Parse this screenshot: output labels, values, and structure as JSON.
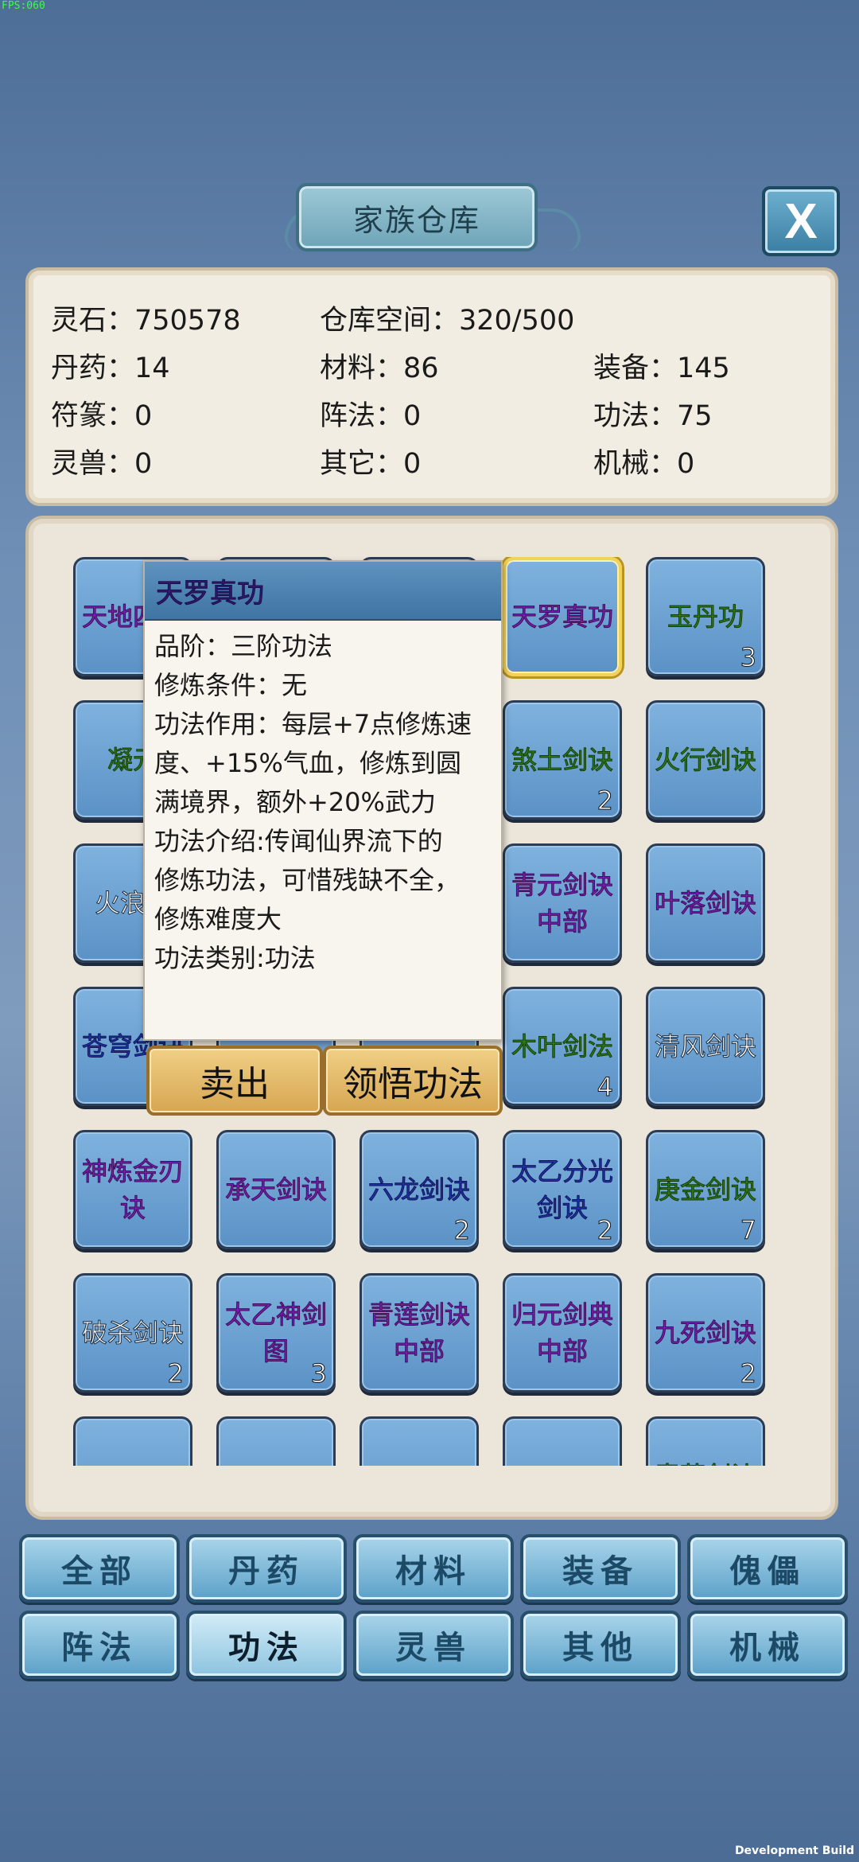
{
  "fps": "FPS:060",
  "dev_build": "Development Build",
  "title": "家族仓库",
  "close_label": "X",
  "stats": {
    "spirit_stone": "灵石：750578",
    "storage": "仓库空间：320/500",
    "pills": "丹药：14",
    "materials": "材料：86",
    "equipment": "装备：145",
    "talismans": "符篆：0",
    "formations": "阵法：0",
    "techniques": "功法：75",
    "beasts": "灵兽：0",
    "others": "其它：0",
    "machines": "机械：0"
  },
  "items": [
    {
      "name": "天地四变",
      "color": "purple",
      "count": ""
    },
    {
      "name": "",
      "color": "purple",
      "count": ""
    },
    {
      "name": "",
      "color": "purple",
      "count": ""
    },
    {
      "name": "天罗真功",
      "color": "purple",
      "count": ""
    },
    {
      "name": "玉丹功",
      "color": "green",
      "count": "3"
    },
    {
      "name": "凝元",
      "color": "green",
      "count": ""
    },
    {
      "name": "",
      "color": "green",
      "count": ""
    },
    {
      "name": "",
      "color": "green",
      "count": ""
    },
    {
      "name": "煞土剑诀",
      "color": "green",
      "count": "2"
    },
    {
      "name": "火行剑诀",
      "color": "green",
      "count": ""
    },
    {
      "name": "火浪剑",
      "color": "white",
      "count": ""
    },
    {
      "name": "",
      "color": "white",
      "count": ""
    },
    {
      "name": "",
      "color": "white",
      "count": ""
    },
    {
      "name": "青元剑诀中部",
      "color": "purple",
      "count": ""
    },
    {
      "name": "叶落剑诀",
      "color": "purple",
      "count": ""
    },
    {
      "name": "苍穹剑诀",
      "color": "blue",
      "count": ""
    },
    {
      "name": "",
      "color": "blue",
      "count": ""
    },
    {
      "name": "",
      "color": "blue",
      "count": ""
    },
    {
      "name": "木叶剑法",
      "color": "green",
      "count": "4"
    },
    {
      "name": "清风剑诀",
      "color": "white",
      "count": ""
    },
    {
      "name": "神炼金刃诀",
      "color": "purple",
      "count": ""
    },
    {
      "name": "承天剑诀",
      "color": "purple",
      "count": ""
    },
    {
      "name": "六龙剑诀",
      "color": "blue",
      "count": "2"
    },
    {
      "name": "太乙分光剑诀",
      "color": "blue",
      "count": "2"
    },
    {
      "name": "庚金剑诀",
      "color": "green",
      "count": "7"
    },
    {
      "name": "破杀剑诀",
      "color": "white",
      "count": "2"
    },
    {
      "name": "太乙神剑图",
      "color": "purple",
      "count": "3"
    },
    {
      "name": "青莲剑诀中部",
      "color": "purple",
      "count": ""
    },
    {
      "name": "归元剑典中部",
      "color": "purple",
      "count": ""
    },
    {
      "name": "九死剑诀",
      "color": "purple",
      "count": "2"
    },
    {
      "name": "",
      "color": "white",
      "count": ""
    },
    {
      "name": "",
      "color": "white",
      "count": ""
    },
    {
      "name": "",
      "color": "white",
      "count": ""
    },
    {
      "name": "",
      "color": "white",
      "count": ""
    },
    {
      "name": "青莲剑诀",
      "color": "green",
      "count": ""
    }
  ],
  "selected_index": 3,
  "tooltip": {
    "title": "天罗真功",
    "lines": [
      "品阶：三阶功法",
      "修炼条件：无",
      "功法作用：每层+7点修炼速",
      "度、+15%气血，修炼到圆",
      "满境界，额外+20%武力",
      "功法介绍:传闻仙界流下的",
      "修炼功法，可惜残缺不全，",
      "修炼难度大",
      "功法类别:功法"
    ],
    "sell_label": "卖出",
    "learn_label": "领悟功法"
  },
  "tabs": [
    {
      "label": "全部",
      "active": false
    },
    {
      "label": "丹药",
      "active": false
    },
    {
      "label": "材料",
      "active": false
    },
    {
      "label": "装备",
      "active": false
    },
    {
      "label": "傀儡",
      "active": false
    },
    {
      "label": "阵法",
      "active": false
    },
    {
      "label": "功法",
      "active": true
    },
    {
      "label": "灵兽",
      "active": false
    },
    {
      "label": "其他",
      "active": false
    },
    {
      "label": "机械",
      "active": false
    }
  ]
}
